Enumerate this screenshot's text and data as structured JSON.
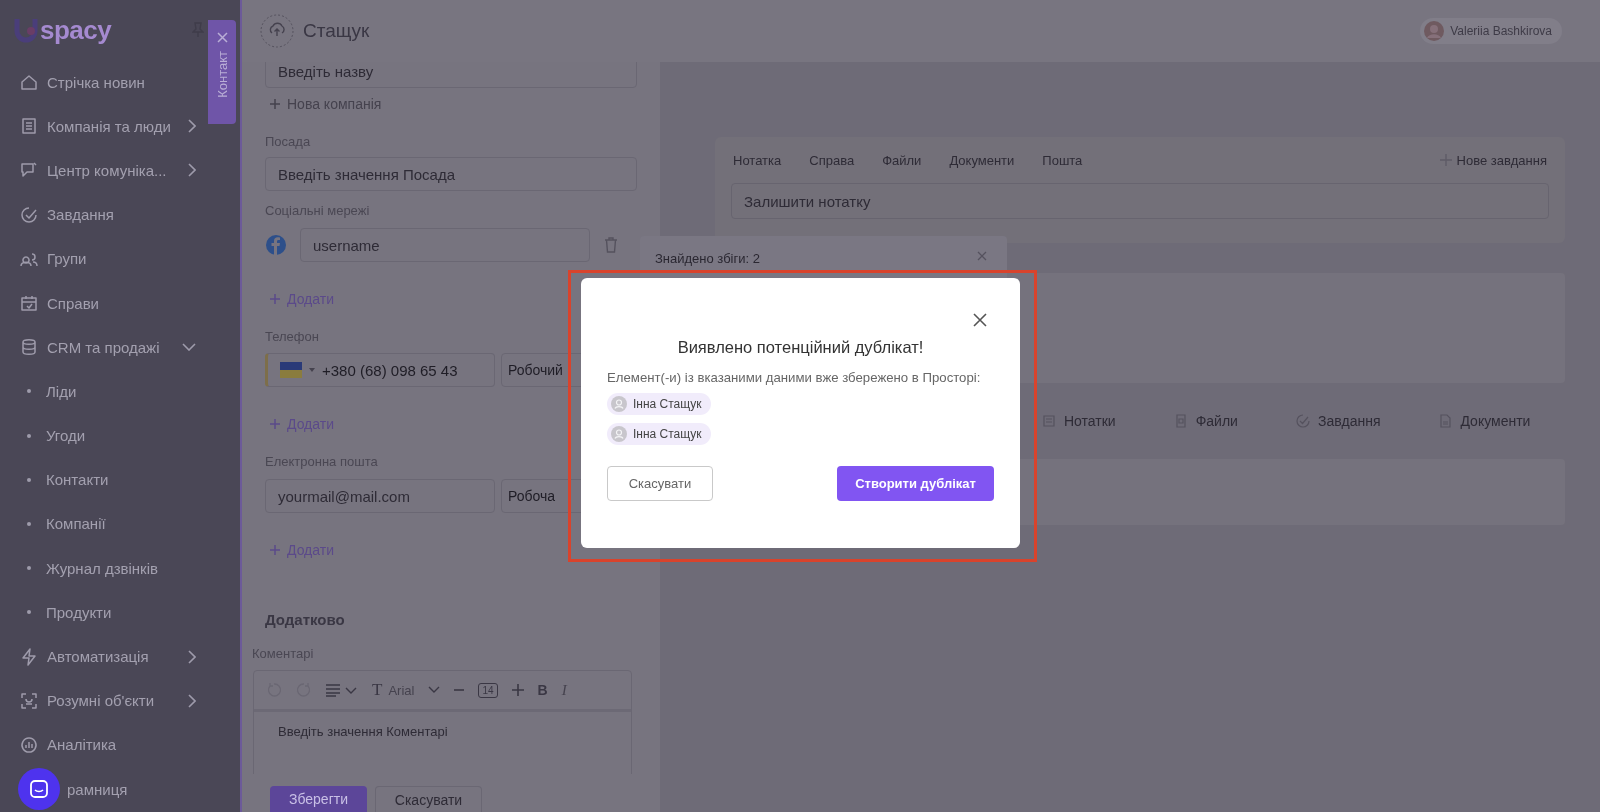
{
  "sidebar": {
    "logo": "spacy",
    "items": [
      {
        "label": "Стрічка новин",
        "kind": "plain"
      },
      {
        "label": "Компанія та люди",
        "kind": "group",
        "expanded": false
      },
      {
        "label": "Центр комуніка...",
        "kind": "group",
        "expanded": false
      },
      {
        "label": "Завдання",
        "kind": "plain"
      },
      {
        "label": "Групи",
        "kind": "plain"
      },
      {
        "label": "Справи",
        "kind": "plain"
      },
      {
        "label": "CRM та продажі",
        "kind": "group",
        "expanded": true
      },
      {
        "label": "Ліди",
        "kind": "sub"
      },
      {
        "label": "Угоди",
        "kind": "sub"
      },
      {
        "label": "Контакти",
        "kind": "sub"
      },
      {
        "label": "Компанії",
        "kind": "sub"
      },
      {
        "label": "Журнал дзвінків",
        "kind": "sub"
      },
      {
        "label": "Продукти",
        "kind": "sub"
      },
      {
        "label": "Автоматизація",
        "kind": "group",
        "expanded": false
      },
      {
        "label": "Розумні об'єкти",
        "kind": "group",
        "expanded": false
      },
      {
        "label": "Аналітика",
        "kind": "plain"
      },
      {
        "label": "рамниця",
        "kind": "plain"
      }
    ]
  },
  "contact_tab": {
    "label": "Контакт"
  },
  "header": {
    "title": "Стащук",
    "user": "Valeriia Bashkirova"
  },
  "form": {
    "company_field": {
      "placeholder": "Введіть назву"
    },
    "new_company": "Нова компанія",
    "position": {
      "label": "Посада",
      "placeholder": "Введіть значення Посада"
    },
    "social": {
      "label": "Соціальні мережі",
      "placeholder": "username",
      "add": "Додати"
    },
    "phone": {
      "label": "Телефон",
      "value": "+380 (68) 098 65 43",
      "type": "Робочий",
      "add": "Додати"
    },
    "email": {
      "label": "Електронна пошта",
      "placeholder": "yourmail@mail.com",
      "type": "Робоча",
      "add": "Додати"
    },
    "additional": {
      "heading": "Додатково",
      "label": "Коментарі",
      "font_icon": "T",
      "font": "Arial",
      "size": "14",
      "bold": "B",
      "italic": "I",
      "placeholder": "Введіть значення Коментарі"
    },
    "buttons": {
      "save": "Зберегти",
      "cancel": "Скасувати"
    }
  },
  "activity": {
    "tabs": [
      "Нотатка",
      "Справа",
      "Файли",
      "Документи",
      "Пошта"
    ],
    "new_task": "Нове завдання",
    "note_placeholder": "Залишити нотатку"
  },
  "record_tabs": [
    "Нотатки",
    "Файли",
    "Завдання",
    "Документи"
  ],
  "matches": {
    "title": "Знайдено збіги: 2"
  },
  "modal": {
    "title": "Виявлено потенційний дублікат!",
    "message": "Елемент(-и) із вказаними даними вже збережено в Просторі:",
    "items": [
      {
        "name": "Інна Стащук"
      },
      {
        "name": "Інна Стащук"
      }
    ],
    "cancel": "Скасувати",
    "confirm": "Створити дублікат"
  }
}
